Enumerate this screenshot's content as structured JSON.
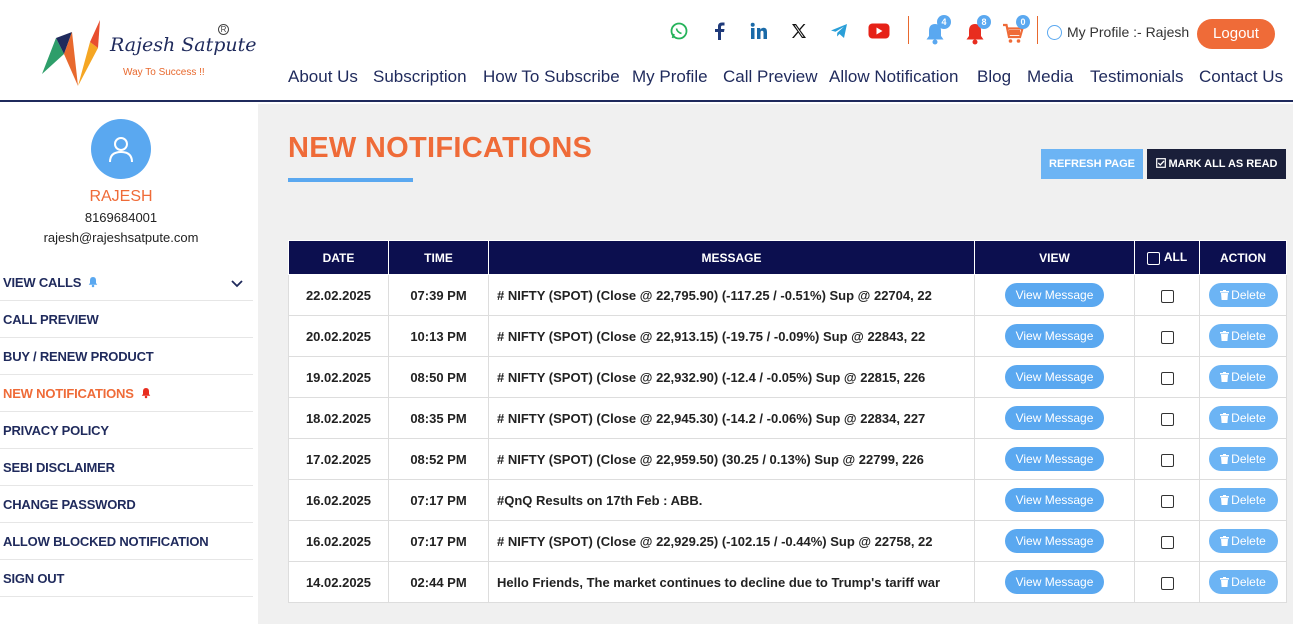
{
  "brand": {
    "name": "Rajesh Satpute",
    "tagline": "Way To Success !!",
    "reg": "R"
  },
  "social": [
    "whatsapp-icon",
    "facebook-icon",
    "linkedin-icon",
    "x-icon",
    "telegram-icon",
    "youtube-icon"
  ],
  "header": {
    "bell_blue_count": "4",
    "bell_red_count": "8",
    "cart_count": "0",
    "profile_label": "My Profile :- Rajesh",
    "logout_label": "Logout"
  },
  "nav": [
    "About Us",
    "Subscription",
    "How To Subscribe",
    "My Profile",
    "Call Preview",
    "Allow Notification",
    "Blog",
    "Media",
    "Testimonials",
    "Contact Us"
  ],
  "colors": {
    "accent": "#ef6b38",
    "primary": "#0c0f4f",
    "blue": "#5aa8f0"
  },
  "user": {
    "name": "RAJESH",
    "phone": "8169684001",
    "email": "rajesh@rajeshsatpute.com"
  },
  "sidebar": {
    "items": [
      {
        "label": "VIEW CALLS"
      },
      {
        "label": "CALL PREVIEW"
      },
      {
        "label": "BUY / RENEW PRODUCT"
      },
      {
        "label": "NEW NOTIFICATIONS"
      },
      {
        "label": "PRIVACY POLICY"
      },
      {
        "label": "SEBI DISCLAIMER"
      },
      {
        "label": "CHANGE PASSWORD"
      },
      {
        "label": "ALLOW BLOCKED NOTIFICATION"
      },
      {
        "label": "SIGN OUT"
      }
    ]
  },
  "main": {
    "title": "NEW NOTIFICATIONS",
    "refresh_label": "REFRESH PAGE",
    "mark_all_label": "MARK ALL AS READ",
    "columns": {
      "date": "DATE",
      "time": "TIME",
      "message": "MESSAGE",
      "view": "VIEW",
      "all": "ALL",
      "action": "ACTION"
    },
    "view_label": "View Message",
    "delete_label": "Delete",
    "rows": [
      {
        "date": "22.02.2025",
        "time": "07:39 PM",
        "message": "# NIFTY (SPOT) (Close @ 22,795.90) (-117.25 / -0.51%) Sup @ 22704, 22"
      },
      {
        "date": "20.02.2025",
        "time": "10:13 PM",
        "message": "# NIFTY (SPOT) (Close @ 22,913.15) (-19.75 / -0.09%) Sup @ 22843, 22"
      },
      {
        "date": "19.02.2025",
        "time": "08:50 PM",
        "message": "# NIFTY (SPOT) (Close @ 22,932.90) (-12.4 / -0.05%) Sup @ 22815, 226"
      },
      {
        "date": "18.02.2025",
        "time": "08:35 PM",
        "message": "# NIFTY (SPOT) (Close @ 22,945.30) (-14.2 / -0.06%) Sup @ 22834, 227"
      },
      {
        "date": "17.02.2025",
        "time": "08:52 PM",
        "message": "# NIFTY (SPOT) (Close @ 22,959.50) (30.25 / 0.13%) Sup @ 22799, 226"
      },
      {
        "date": "16.02.2025",
        "time": "07:17 PM",
        "message": "#QnQ Results on 17th Feb : ABB."
      },
      {
        "date": "16.02.2025",
        "time": "07:17 PM",
        "message": "# NIFTY (SPOT) (Close @ 22,929.25) (-102.15 / -0.44%) Sup @ 22758, 22"
      },
      {
        "date": "14.02.2025",
        "time": "02:44 PM",
        "message": "Hello Friends, The market continues to decline due to Trump's tariff war"
      }
    ]
  }
}
